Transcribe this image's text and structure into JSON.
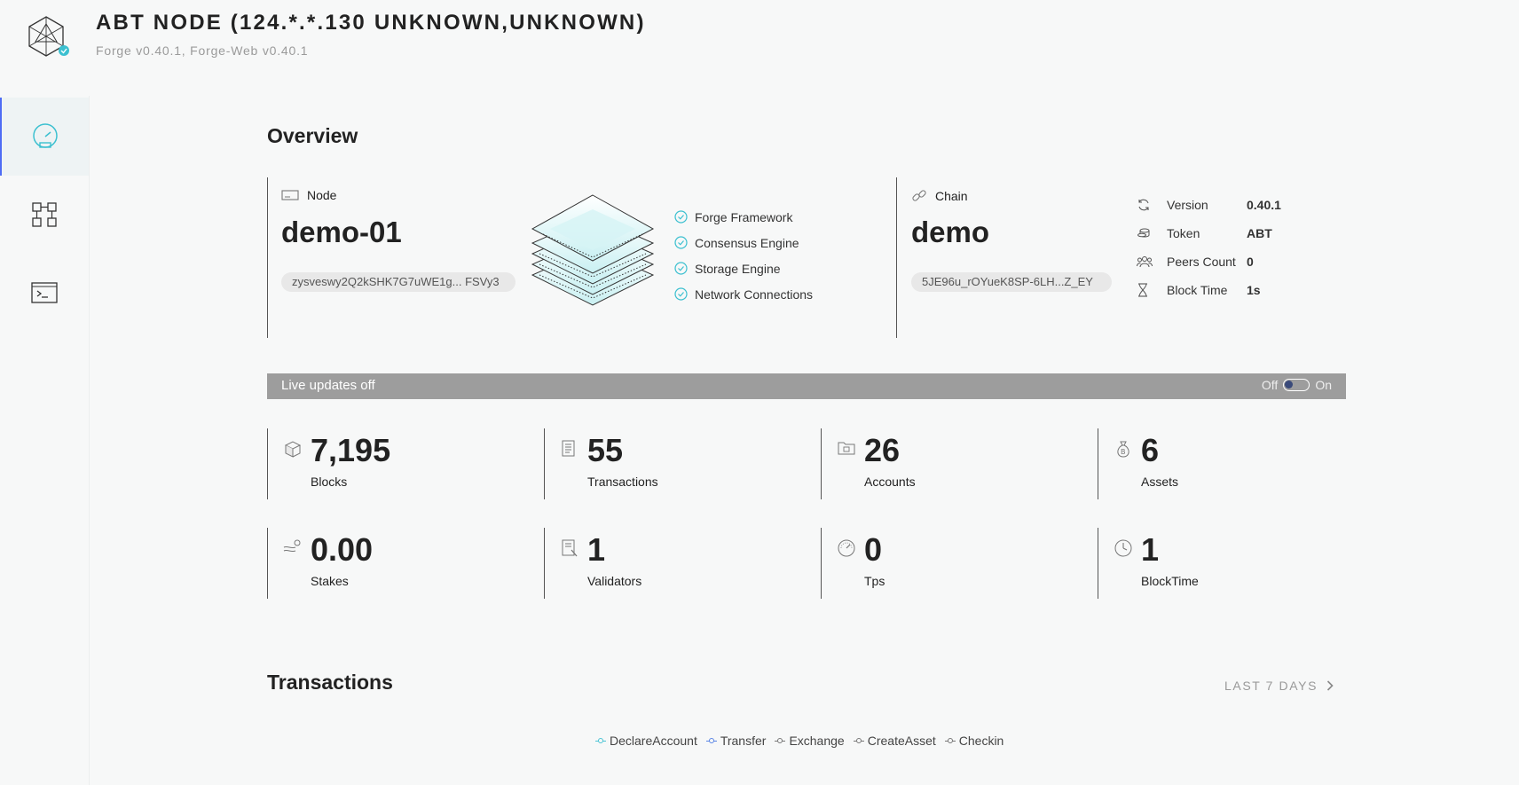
{
  "header": {
    "title": "ABT NODE (124.*.*.130 UNKNOWN,UNKNOWN)",
    "subtitle": "Forge v0.40.1, Forge-Web v0.40.1"
  },
  "sidebar": {
    "items": [
      {
        "name": "dashboard",
        "icon": "gauge-icon",
        "active": true
      },
      {
        "name": "explorer",
        "icon": "blocks-grid-icon",
        "active": false
      },
      {
        "name": "console",
        "icon": "terminal-icon",
        "active": false
      }
    ]
  },
  "overview": {
    "title": "Overview",
    "node": {
      "label": "Node",
      "name": "demo-01",
      "address": "zysveswy2Q2kSHK7G7uWE1g... FSVy3"
    },
    "checks": [
      "Forge Framework",
      "Consensus Engine",
      "Storage Engine",
      "Network Connections"
    ],
    "chain": {
      "label": "Chain",
      "name": "demo",
      "id": "5JE96u_rOYueK8SP-6LH...Z_EY"
    },
    "meta": [
      {
        "label": "Version",
        "value": "0.40.1",
        "icon": "refresh-icon"
      },
      {
        "label": "Token",
        "value": "ABT",
        "icon": "coins-icon"
      },
      {
        "label": "Peers Count",
        "value": "0",
        "icon": "peers-icon"
      },
      {
        "label": "Block Time",
        "value": "1s",
        "icon": "hourglass-icon"
      }
    ]
  },
  "live": {
    "text": "Live updates off",
    "off_label": "Off",
    "on_label": "On"
  },
  "stats": [
    {
      "value": "7,195",
      "label": "Blocks",
      "icon": "cube-icon"
    },
    {
      "value": "55",
      "label": "Transactions",
      "icon": "receipt-icon"
    },
    {
      "value": "26",
      "label": "Accounts",
      "icon": "folder-account-icon"
    },
    {
      "value": "6",
      "label": "Assets",
      "icon": "money-bag-icon"
    },
    {
      "value": "0.00",
      "label": "Stakes",
      "icon": "stake-icon"
    },
    {
      "value": "1",
      "label": "Validators",
      "icon": "validator-doc-icon"
    },
    {
      "value": "0",
      "label": "Tps",
      "icon": "speedometer-icon"
    },
    {
      "value": "1",
      "label": "BlockTime",
      "icon": "clock-icon"
    }
  ],
  "transactions": {
    "title": "Transactions",
    "range_label": "LAST 7 DAYS",
    "legend": [
      {
        "name": "DeclareAccount",
        "color": "#4cc4d4"
      },
      {
        "name": "Transfer",
        "color": "#5b86e5"
      },
      {
        "name": "Exchange",
        "color": "#777777"
      },
      {
        "name": "CreateAsset",
        "color": "#777777"
      },
      {
        "name": "Checkin",
        "color": "#777777"
      }
    ]
  }
}
